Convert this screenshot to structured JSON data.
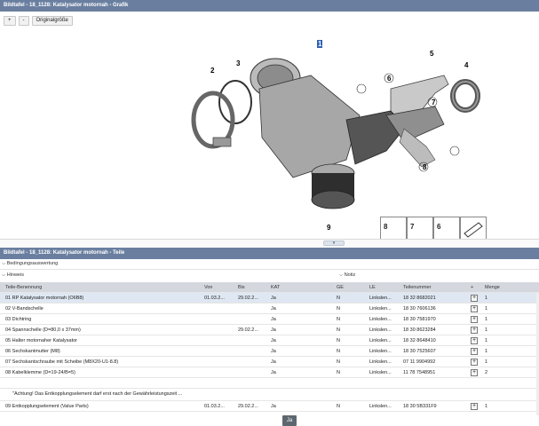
{
  "top_panel": {
    "title": "Bildtafel - 18_1128: Katalysator motornah - Grafik",
    "zoom_in": "+",
    "zoom_out": "-",
    "original_size": "Originalgröße"
  },
  "diagram": {
    "callouts": [
      "1",
      "2",
      "3",
      "4",
      "5",
      "6",
      "7",
      "8",
      "9"
    ],
    "hardware_labels": [
      "8",
      "7",
      "6"
    ]
  },
  "bottom_panel": {
    "title": "Bildtafel - 18_1128: Katalysator motornah - Teile",
    "condition_section": "Bedingungsauswertung",
    "hint_section": "Hinweis",
    "notes_section": "Notiz"
  },
  "table": {
    "headers": [
      "Teile-Benennung",
      "Von",
      "Bis",
      "KAT",
      "GE",
      "LE",
      "Teilenummer",
      "+",
      "Menge"
    ],
    "rows": [
      {
        "name": "01 RP Katalysator motornah (O6B8)",
        "von": "01.03.2...",
        "bis": "29.02.2...",
        "kat": "Ja",
        "ge": "N",
        "le": "Linkslen...",
        "teilenummer": "18 32 8682021",
        "menge": "1",
        "selected": true
      },
      {
        "name": "02 V-Bandschelle",
        "von": "",
        "bis": "",
        "kat": "Ja",
        "ge": "N",
        "le": "Linkslen...",
        "teilenummer": "18 30 7606136",
        "menge": "1"
      },
      {
        "name": "03 Dichtring",
        "von": "",
        "bis": "",
        "kat": "Ja",
        "ge": "N",
        "le": "Linkslen...",
        "teilenummer": "18 30 7581970",
        "menge": "1"
      },
      {
        "name": "04 Spannschelle (D=80,0 x 37mm)",
        "von": "",
        "bis": "29.02.2...",
        "kat": "Ja",
        "ge": "N",
        "le": "Linkslen...",
        "teilenummer": "18 30 8623284",
        "menge": "1"
      },
      {
        "name": "05 Halter motornaher Katalysator",
        "von": "",
        "bis": "",
        "kat": "Ja",
        "ge": "N",
        "le": "Linkslen...",
        "teilenummer": "18 32 8648410",
        "menge": "1"
      },
      {
        "name": "06 Sechskantmutter (M8)",
        "von": "",
        "bis": "",
        "kat": "Ja",
        "ge": "N",
        "le": "Linkslen...",
        "teilenummer": "18 30 7525607",
        "menge": "1"
      },
      {
        "name": "07 Sechskantschraube mit Scheibe (M8X20-U1-8.8)",
        "von": "",
        "bis": "",
        "kat": "Ja",
        "ge": "N",
        "le": "Linkslen...",
        "teilenummer": "07 11 9904992",
        "menge": "1"
      },
      {
        "name": "08 Kabelklemme (D=19-24/B=5)",
        "von": "",
        "bis": "",
        "kat": "Ja",
        "ge": "N",
        "le": "Linkslen...",
        "teilenummer": "11 78 7548951",
        "menge": "2"
      }
    ],
    "note_text": "\"Achtung! Das Entkopplungselement darf erst nach der Gewährleistungszeit ...",
    "last_row": {
      "name": "09 Entkopplungselement (Value Parts)",
      "von": "01.03.2...",
      "bis": "29.02.2...",
      "kat": "Ja",
      "ge": "N",
      "le": "Linkslen...",
      "teilenummer": "18 30 5B331F9",
      "menge": "1"
    }
  },
  "pager": {
    "label": "Ja"
  }
}
